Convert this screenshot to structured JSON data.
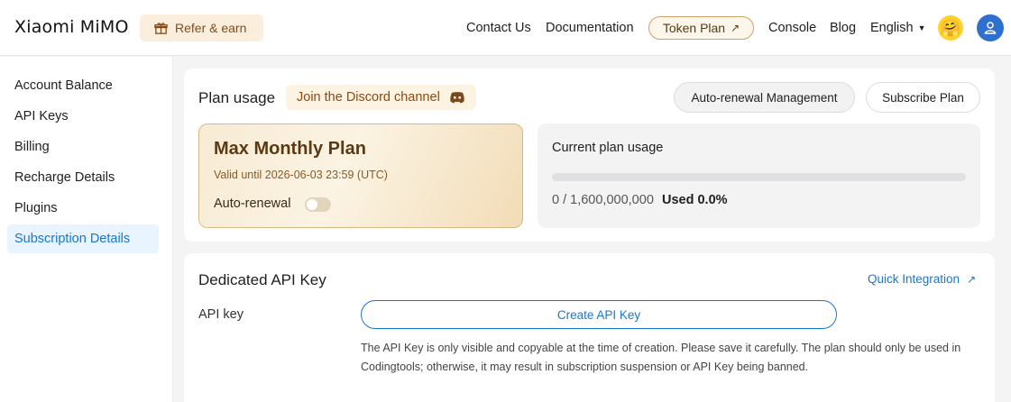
{
  "header": {
    "logo": "Xiaomi MiMO",
    "refer_label": "Refer & earn",
    "nav": {
      "contact": "Contact Us",
      "docs": "Documentation",
      "token_plan": "Token Plan",
      "console": "Console",
      "blog": "Blog",
      "language": "English"
    },
    "emoji": "🤗"
  },
  "sidebar": {
    "items": [
      {
        "label": "Account Balance"
      },
      {
        "label": "API Keys"
      },
      {
        "label": "Billing"
      },
      {
        "label": "Recharge Details"
      },
      {
        "label": "Plugins"
      },
      {
        "label": "Subscription Details"
      }
    ]
  },
  "plan_usage": {
    "title": "Plan usage",
    "discord_label": "Join the Discord channel",
    "auto_renewal_button": "Auto-renewal Management",
    "subscribe_button": "Subscribe Plan",
    "plan_name": "Max Monthly Plan",
    "valid_until": "Valid until 2026-06-03 23:59 (UTC)",
    "auto_renewal_label": "Auto-renewal",
    "auto_renewal_on": false,
    "usage_title": "Current plan usage",
    "usage_count": "0 / 1,600,000,000",
    "usage_percent_label": "Used 0.0%",
    "usage_fraction": 0.0
  },
  "api_key": {
    "title": "Dedicated API Key",
    "quick_integration": "Quick Integration",
    "label": "API key",
    "create_button": "Create API Key",
    "note": "The API Key is only visible and copyable at the time of creation. Please save it carefully. The plan should only be used in Codingtools; otherwise, it may result in subscription suspension or API Key being banned."
  },
  "colors": {
    "accent": "#1677d2",
    "active_bg": "#eaf4ff",
    "refer_bg": "#fbeedd",
    "plan_text": "#5a3a14"
  }
}
